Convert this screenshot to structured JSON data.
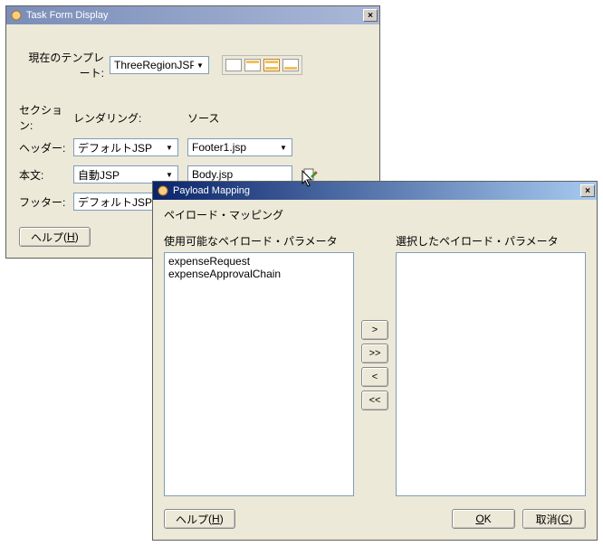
{
  "taskForm": {
    "title": "Task Form Display",
    "currentTemplateLabel": "現在のテンプレート:",
    "currentTemplateValue": "ThreeRegionJSP",
    "sectionHeader": "セクション:",
    "renderingHeader": "レンダリング:",
    "sourceHeader": "ソース",
    "rows": {
      "header": {
        "label": "ヘッダー:",
        "rendering": "デフォルトJSP",
        "source": "Footer1.jsp"
      },
      "body": {
        "label": "本文:",
        "rendering": "自動JSP",
        "source": "Body.jsp"
      },
      "footer": {
        "label": "フッター:",
        "rendering": "デフォルトJSP",
        "source": ""
      }
    },
    "helpLabel": "ヘルプ",
    "helpAccel": "H"
  },
  "payload": {
    "title": "Payload Mapping",
    "subtitle": "ペイロード・マッピング",
    "availableLabel": "使用可能なペイロード・パラメータ",
    "selectedLabel": "選択したペイロード・パラメータ",
    "availableItems": [
      "expenseRequest",
      "expenseApprovalChain"
    ],
    "selectedItems": [],
    "helpLabel": "ヘルプ",
    "helpAccel": "H",
    "okLabel": "O",
    "okAccel": "K",
    "cancelLabel": "取消",
    "cancelAccel": "C",
    "moveRight": ">",
    "moveAllRight": ">>",
    "moveLeft": "<",
    "moveAllLeft": "<<"
  }
}
